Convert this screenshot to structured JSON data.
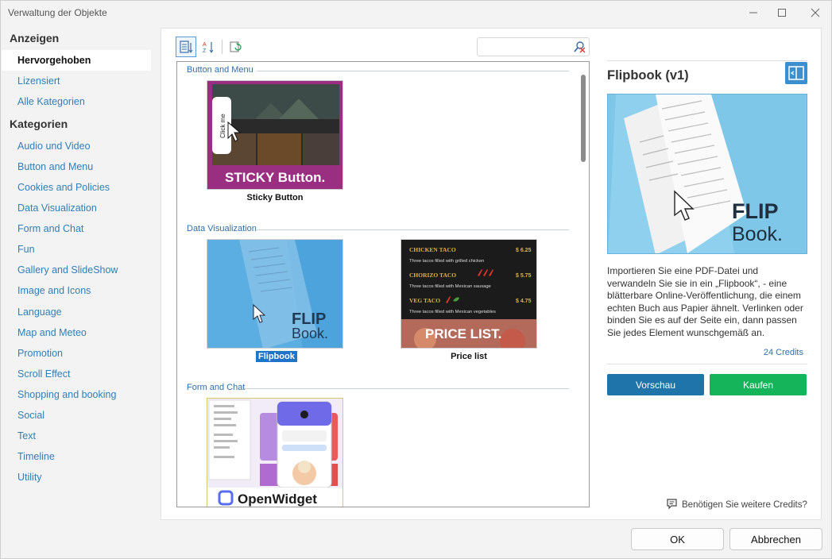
{
  "window": {
    "title": "Verwaltung der Objekte"
  },
  "sidebar": {
    "heading_show": "Anzeigen",
    "show_items": [
      "Hervorgehoben",
      "Lizensiert",
      "Alle Kategorien"
    ],
    "heading_categories": "Kategorien",
    "categories": [
      "Audio und Video",
      "Button and Menu",
      "Cookies and Policies",
      "Data Visualization",
      "Form and Chat",
      "Fun",
      "Gallery and SlideShow",
      "Image and Icons",
      "Language",
      "Map and Meteo",
      "Promotion",
      "Scroll Effect",
      "Shopping and booking",
      "Social",
      "Text",
      "Timeline",
      "Utility"
    ]
  },
  "search": {
    "value": "",
    "placeholder": ""
  },
  "list": {
    "groups": [
      {
        "label": "Button and Menu",
        "items": [
          {
            "caption": "Sticky Button",
            "image_title": "STICKY Button.",
            "tab_text": "Click me"
          }
        ]
      },
      {
        "label": "Data Visualization",
        "items": [
          {
            "caption": "Flipbook",
            "image_title_1": "FLIP",
            "image_title_2": "Book."
          },
          {
            "caption": "Price list",
            "image_title": "PRICE LIST.",
            "menu": [
              {
                "name": "CHICKEN TACO",
                "price": "$ 6.25",
                "desc": "Three tacos filled with grilled chicken"
              },
              {
                "name": "CHORIZO TACO",
                "price": "$ 5.75",
                "desc": "Three tacos filled with Mexican sausage"
              },
              {
                "name": "VEG TACO",
                "price": "$ 4.75",
                "desc": "Three tacos filled with Mexican vegetables"
              }
            ]
          }
        ]
      },
      {
        "label": "Form and Chat",
        "items": [
          {
            "caption": "",
            "image_title": "OpenWidget"
          }
        ]
      }
    ]
  },
  "detail": {
    "title": "Flipbook (v1)",
    "image_title_1": "FLIP",
    "image_title_2": "Book.",
    "description": "Importieren Sie eine PDF-Datei und verwandeln Sie sie in ein „Flipbook“, - eine blätterbare Online-Veröffentlichung, die einem echten Buch aus Papier ähnelt. Verlinken oder binden Sie es auf der Seite ein, dann passen Sie jedes Element wunschgemäß an.",
    "credits": "24 Credits",
    "preview_label": "Vorschau",
    "buy_label": "Kaufen",
    "more_credits": "Benötigen Sie weitere Credits?"
  },
  "footer": {
    "ok_label": "OK",
    "cancel_label": "Abbrechen"
  },
  "colors": {
    "accent": "#2f7fb8",
    "preview": "#1f74a9",
    "buy": "#16b45a",
    "selected": "#1f74c8"
  }
}
